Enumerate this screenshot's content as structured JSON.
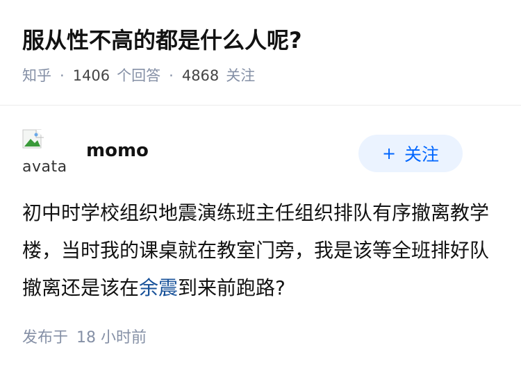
{
  "question": {
    "title": "服从性不高的都是什么人呢?",
    "meta": {
      "source": "知乎",
      "separator": "·",
      "answer_count": "1406",
      "answer_label": "个回答",
      "follower_count": "4868",
      "follower_label": "关注"
    }
  },
  "answer": {
    "author": {
      "name": "momo",
      "avatar_alt": "avatar"
    },
    "follow_button": {
      "icon": "plus-icon",
      "label": "关注",
      "colors": {
        "background": "#ebf3ff",
        "text": "#0066ff"
      }
    },
    "content": {
      "before_link": "初中时学校组织地震演练班主任组织排队有序撤离教学楼，当时我的课桌就在教室门旁，我是该等全班排好队撤离还是该在",
      "link_text": "余震",
      "after_link": "到来前跑路?"
    },
    "published": {
      "label": "发布于",
      "time": "18 小时前"
    }
  }
}
